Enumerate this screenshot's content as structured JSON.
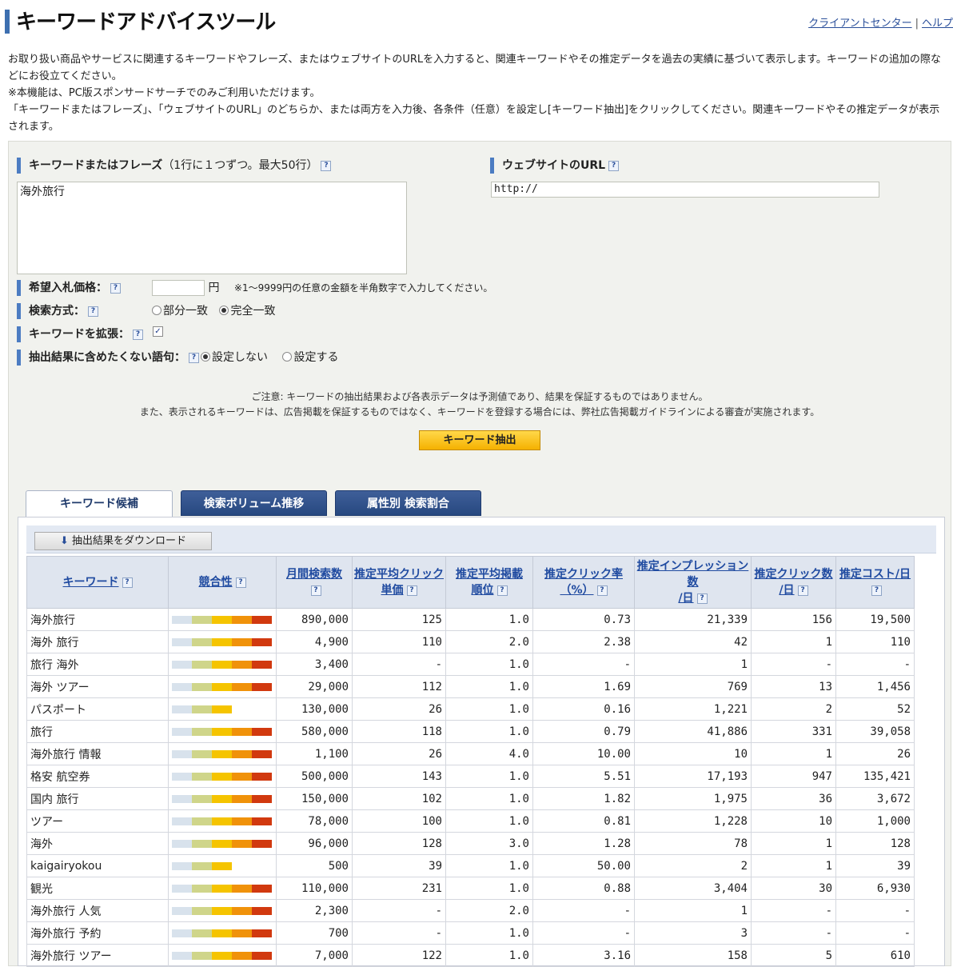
{
  "header": {
    "title": "キーワードアドバイスツール",
    "client_center": "クライアントセンター",
    "separator": "|",
    "help": "ヘルプ"
  },
  "intro": {
    "line1": "お取り扱い商品やサービスに関連するキーワードやフレーズ、またはウェブサイトのURLを入力すると、関連キーワードやその推定データを過去の実績に基づいて表示します。キーワードの追加の際などにお役立てください。",
    "line2": "※本機能は、PC版スポンサードサーチでのみご利用いただけます。",
    "line3": "「キーワードまたはフレーズ」、「ウェブサイトのURL」のどちらか、または両方を入力後、各条件（任意）を設定し[キーワード抽出]をクリックしてください。関連キーワードやその推定データが表示されます。"
  },
  "form": {
    "keyword_label": "キーワードまたはフレーズ",
    "keyword_note": "（1行に１つずつ。最大50行）",
    "keyword_value": "海外旅行",
    "url_label": "ウェブサイトのURL",
    "url_value": "http://",
    "bid_label": "希望入札価格：",
    "bid_unit": "円",
    "bid_note": "※1～9999円の任意の金額を半角数字で入力してください。",
    "match_label": "検索方式：",
    "match_partial": "部分一致",
    "match_exact": "完全一致",
    "expand_label": "キーワードを拡張：",
    "exclude_label": "抽出結果に含めたくない語句：",
    "exclude_off": "設定しない",
    "exclude_on": "設定する",
    "help_mark": "?"
  },
  "notice": {
    "line1": "ご注意: キーワードの抽出結果および各表示データは予測値であり、結果を保証するものではありません。",
    "line2": "また、表示されるキーワードは、広告掲載を保証するものではなく、キーワードを登録する場合には、弊社広告掲載ガイドラインによる審査が実施されます。"
  },
  "extract_button": "キーワード抽出",
  "tabs": [
    "キーワード候補",
    "検索ボリューム推移",
    "属性別 検索割合"
  ],
  "download_button": "抽出結果をダウンロード",
  "colors": {
    "competition": [
      "#d8e2ec",
      "#cfd58a",
      "#f5c400",
      "#f0920a",
      "#d1390f"
    ]
  },
  "table": {
    "headers": [
      {
        "l1": "キーワード",
        "l2": ""
      },
      {
        "l1": "競合性",
        "l2": ""
      },
      {
        "l1": "月間検索数",
        "l2": ""
      },
      {
        "l1": "推定平均クリック",
        "l2": "単価"
      },
      {
        "l1": "推定平均掲載",
        "l2": "順位"
      },
      {
        "l1": "推定クリック率",
        "l2": "（%）"
      },
      {
        "l1": "推定インプレッション数",
        "l2": "/日"
      },
      {
        "l1": "推定クリック数",
        "l2": "/日"
      },
      {
        "l1": "推定コスト/日",
        "l2": ""
      }
    ],
    "rows": [
      {
        "keyword": "海外旅行",
        "competition": 5,
        "monthly": "890,000",
        "cpc": "125",
        "position": "1.0",
        "ctr": "0.73",
        "impressions": "21,339",
        "clicks": "156",
        "cost": "19,500"
      },
      {
        "keyword": "海外 旅行",
        "competition": 5,
        "monthly": "4,900",
        "cpc": "110",
        "position": "2.0",
        "ctr": "2.38",
        "impressions": "42",
        "clicks": "1",
        "cost": "110"
      },
      {
        "keyword": "旅行 海外",
        "competition": 5,
        "monthly": "3,400",
        "cpc": "-",
        "position": "1.0",
        "ctr": "-",
        "impressions": "1",
        "clicks": "-",
        "cost": "-"
      },
      {
        "keyword": "海外 ツアー",
        "competition": 5,
        "monthly": "29,000",
        "cpc": "112",
        "position": "1.0",
        "ctr": "1.69",
        "impressions": "769",
        "clicks": "13",
        "cost": "1,456"
      },
      {
        "keyword": "パスポート",
        "competition": 3,
        "monthly": "130,000",
        "cpc": "26",
        "position": "1.0",
        "ctr": "0.16",
        "impressions": "1,221",
        "clicks": "2",
        "cost": "52"
      },
      {
        "keyword": "旅行",
        "competition": 5,
        "monthly": "580,000",
        "cpc": "118",
        "position": "1.0",
        "ctr": "0.79",
        "impressions": "41,886",
        "clicks": "331",
        "cost": "39,058"
      },
      {
        "keyword": "海外旅行 情報",
        "competition": 5,
        "monthly": "1,100",
        "cpc": "26",
        "position": "4.0",
        "ctr": "10.00",
        "impressions": "10",
        "clicks": "1",
        "cost": "26"
      },
      {
        "keyword": "格安 航空券",
        "competition": 5,
        "monthly": "500,000",
        "cpc": "143",
        "position": "1.0",
        "ctr": "5.51",
        "impressions": "17,193",
        "clicks": "947",
        "cost": "135,421"
      },
      {
        "keyword": "国内 旅行",
        "competition": 5,
        "monthly": "150,000",
        "cpc": "102",
        "position": "1.0",
        "ctr": "1.82",
        "impressions": "1,975",
        "clicks": "36",
        "cost": "3,672"
      },
      {
        "keyword": "ツアー",
        "competition": 5,
        "monthly": "78,000",
        "cpc": "100",
        "position": "1.0",
        "ctr": "0.81",
        "impressions": "1,228",
        "clicks": "10",
        "cost": "1,000"
      },
      {
        "keyword": "海外",
        "competition": 5,
        "monthly": "96,000",
        "cpc": "128",
        "position": "3.0",
        "ctr": "1.28",
        "impressions": "78",
        "clicks": "1",
        "cost": "128"
      },
      {
        "keyword": "kaigairyokou",
        "competition": 3,
        "monthly": "500",
        "cpc": "39",
        "position": "1.0",
        "ctr": "50.00",
        "impressions": "2",
        "clicks": "1",
        "cost": "39"
      },
      {
        "keyword": "観光",
        "competition": 5,
        "monthly": "110,000",
        "cpc": "231",
        "position": "1.0",
        "ctr": "0.88",
        "impressions": "3,404",
        "clicks": "30",
        "cost": "6,930"
      },
      {
        "keyword": "海外旅行 人気",
        "competition": 5,
        "monthly": "2,300",
        "cpc": "-",
        "position": "2.0",
        "ctr": "-",
        "impressions": "1",
        "clicks": "-",
        "cost": "-"
      },
      {
        "keyword": "海外旅行 予約",
        "competition": 5,
        "monthly": "700",
        "cpc": "-",
        "position": "1.0",
        "ctr": "-",
        "impressions": "3",
        "clicks": "-",
        "cost": "-"
      },
      {
        "keyword": "海外旅行 ツアー",
        "competition": 5,
        "monthly": "7,000",
        "cpc": "122",
        "position": "1.0",
        "ctr": "3.16",
        "impressions": "158",
        "clicks": "5",
        "cost": "610"
      }
    ]
  }
}
